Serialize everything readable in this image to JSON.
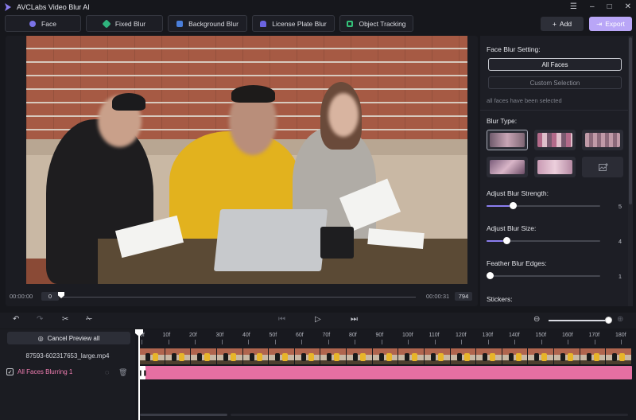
{
  "app": {
    "title": "AVCLabs Video Blur AI"
  },
  "window_controls": [
    "☰",
    "–",
    "□",
    "✕"
  ],
  "modes": [
    {
      "label": "Face",
      "icon": "face-icon",
      "color": "#7b73e8"
    },
    {
      "label": "Fixed Blur",
      "icon": "fixed-blur-icon",
      "color": "#2fb37d"
    },
    {
      "label": "Background Blur",
      "icon": "background-blur-icon",
      "color": "#4a7ed9"
    },
    {
      "label": "License Plate Blur",
      "icon": "license-plate-icon",
      "color": "#6a63e0"
    },
    {
      "label": "Object Tracking",
      "icon": "object-tracking-icon",
      "color": "#34c27a"
    }
  ],
  "actions": {
    "add_label": "Add",
    "export_label": "Export",
    "add_icon": "+",
    "export_icon": "⇥"
  },
  "preview": {
    "time_start": "00:00:00",
    "frame_start": "0",
    "time_end": "00:00:31",
    "frame_end": "794"
  },
  "panel": {
    "face_blur_setting": "Face Blur Setting:",
    "all_faces": "All Faces",
    "custom_selection": "Custom Selection",
    "note": "all faces have been selected",
    "blur_type": "Blur Type:",
    "blur_strength": {
      "label": "Adjust Blur Strength:",
      "value": "5",
      "fraction": 0.2
    },
    "blur_size": {
      "label": "Adjust Blur Size:",
      "value": "4",
      "fraction": 0.15
    },
    "feather": {
      "label": "Feather Blur Edges:",
      "value": "1",
      "fraction": 0.0
    },
    "stickers": "Stickers:"
  },
  "timeline": {
    "cancel_preview": "Cancel Preview all",
    "file_name": "87593-602317653_large.mp4",
    "track_name": "All Faces Blurring 1",
    "ruler": [
      "0f",
      "10f",
      "20f",
      "30f",
      "40f",
      "50f",
      "60f",
      "70f",
      "80f",
      "90f",
      "100f",
      "110f",
      "120f",
      "130f",
      "140f",
      "150f",
      "160f",
      "170f",
      "180f"
    ]
  },
  "colors": {
    "accent": "#8b7ef0",
    "track": "#e56fa2",
    "export": "#b9a6f7"
  }
}
